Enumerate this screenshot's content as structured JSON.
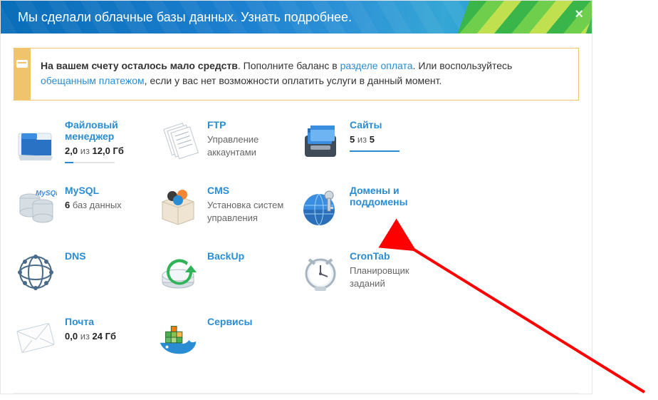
{
  "banner": {
    "text": "Мы сделали облачные базы данных. Узнать подробнее.",
    "close_title": "Закрыть"
  },
  "notice": {
    "bold": "На вашем счету осталось мало средств",
    "text1": ". Пополните баланс в ",
    "link1": "разделе оплата",
    "text2": ". Или воспользуйтесь ",
    "link2": "обещанным платежом",
    "text3": ", если у вас нет возможности оплатить услуги в данный момент."
  },
  "tiles": {
    "file_manager": {
      "title": "Файловый менеджер",
      "metric_used": "2,0",
      "metric_joiner": " из ",
      "metric_total": "12,0 Гб",
      "progress": 17
    },
    "ftp": {
      "title": "FTP",
      "sub": "Управление аккаунтами"
    },
    "sites": {
      "title": "Сайты",
      "metric_used": "5",
      "metric_joiner": " из ",
      "metric_total": "5",
      "progress": 100
    },
    "mysql": {
      "title": "MySQL",
      "metric_used": "6",
      "metric_label": " баз данных"
    },
    "cms": {
      "title": "CMS",
      "sub": "Установка систем управления"
    },
    "domains": {
      "title": "Домены и поддомены"
    },
    "dns": {
      "title": "DNS"
    },
    "backup": {
      "title": "BackUp"
    },
    "crontab": {
      "title": "CronTab",
      "sub": "Планировщик заданий"
    },
    "mail": {
      "title": "Почта",
      "metric_used": "0,0",
      "metric_joiner": " из ",
      "metric_total": "24 Гб"
    },
    "services": {
      "title": "Сервисы"
    }
  }
}
